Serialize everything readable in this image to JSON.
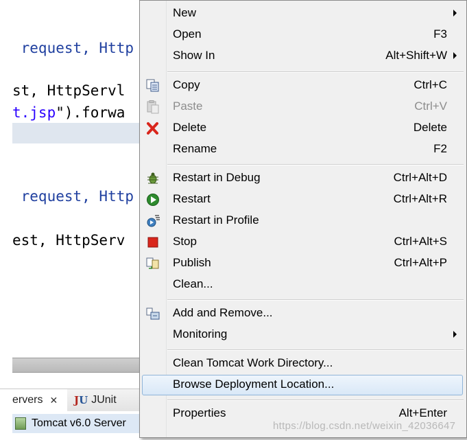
{
  "editor": {
    "lines": [
      {
        "parts": [
          {
            "t": " request, Http",
            "c": "kw"
          }
        ]
      },
      {
        "parts": [
          {
            "t": "st, HttpServl",
            "c": ""
          }
        ]
      },
      {
        "parts": [
          {
            "t": "t.jsp",
            "c": "str"
          },
          {
            "t": "\").forwa",
            "c": ""
          }
        ]
      },
      {
        "parts": [
          {
            "t": " request, Http",
            "c": "kw"
          }
        ]
      },
      {
        "parts": [
          {
            "t": "est, HttpServ",
            "c": ""
          }
        ]
      }
    ]
  },
  "bottom": {
    "tab_servers_label": "ervers",
    "tab_junit_label": "JUnit",
    "junit_icon_j": "J",
    "junit_icon_u": "U",
    "server_row_label": "Tomcat v6.0 Server"
  },
  "menu": {
    "items": [
      {
        "label": "New",
        "accel": "",
        "submenu": true,
        "icon": ""
      },
      {
        "label": "Open",
        "accel": "F3",
        "submenu": false,
        "icon": ""
      },
      {
        "label": "Show In",
        "accel": "Alt+Shift+W",
        "submenu": true,
        "icon": ""
      },
      {
        "label": "Copy",
        "accel": "Ctrl+C",
        "submenu": false,
        "icon": "copy-icon"
      },
      {
        "label": "Paste",
        "accel": "Ctrl+V",
        "submenu": false,
        "icon": "paste-icon",
        "disabled": true
      },
      {
        "label": "Delete",
        "accel": "Delete",
        "submenu": false,
        "icon": "delete-icon"
      },
      {
        "label": "Rename",
        "accel": "F2",
        "submenu": false,
        "icon": ""
      },
      {
        "label": "Restart in Debug",
        "accel": "Ctrl+Alt+D",
        "submenu": false,
        "icon": "debug-bug-icon"
      },
      {
        "label": "Restart",
        "accel": "Ctrl+Alt+R",
        "submenu": false,
        "icon": "run-icon"
      },
      {
        "label": "Restart in Profile",
        "accel": "",
        "submenu": false,
        "icon": "profile-icon"
      },
      {
        "label": "Stop",
        "accel": "Ctrl+Alt+S",
        "submenu": false,
        "icon": "stop-icon"
      },
      {
        "label": "Publish",
        "accel": "Ctrl+Alt+P",
        "submenu": false,
        "icon": "publish-icon"
      },
      {
        "label": "Clean...",
        "accel": "",
        "submenu": false,
        "icon": ""
      },
      {
        "label": "Add and Remove...",
        "accel": "",
        "submenu": false,
        "icon": "add-remove-icon"
      },
      {
        "label": "Monitoring",
        "accel": "",
        "submenu": true,
        "icon": ""
      },
      {
        "label": "Clean Tomcat Work Directory...",
        "accel": "",
        "submenu": false,
        "icon": ""
      },
      {
        "label": "Browse Deployment Location...",
        "accel": "",
        "submenu": false,
        "icon": "",
        "selected": true
      },
      {
        "label": "Properties",
        "accel": "Alt+Enter",
        "submenu": false,
        "icon": ""
      }
    ]
  },
  "watermark": "https://blog.csdn.net/weixin_42036647",
  "colors": {
    "menu_bg": "#f0f0f0",
    "selection_border": "#8fb4d8",
    "disabled_text": "#8d8d8d",
    "keyword_blue": "#1f3f9f",
    "string_blue": "#2a00ff",
    "delete_red": "#d9261c",
    "run_green": "#2e8b2e"
  }
}
